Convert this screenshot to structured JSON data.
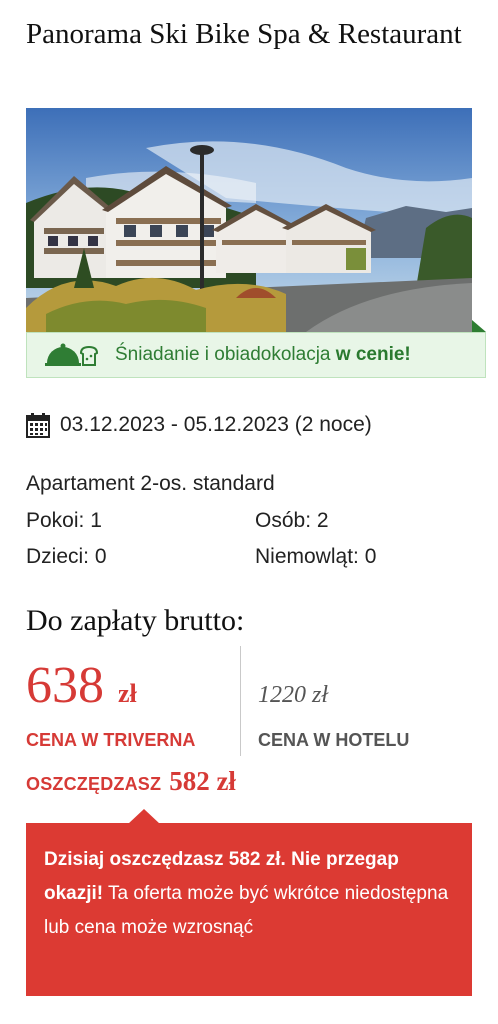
{
  "hotel": {
    "name": "Panorama Ski Bike Spa & Restaurant"
  },
  "badge": {
    "icon": "cloche-bread-icon",
    "text": "Śniadanie i obiadokolacja ",
    "emphasis": "w cenie!"
  },
  "stay": {
    "icon": "calendar-icon",
    "dates": "03.12.2023 - 05.12.2023 (2 noce)",
    "room_type": "Apartament 2-os. standard",
    "rooms_label": "Pokoi: 1",
    "persons_label": "Osób: 2",
    "children_label": "Dzieci: 0",
    "infants_label": "Niemowląt: 0"
  },
  "payment": {
    "title": "Do zapłaty brutto:",
    "triverna_price": "638",
    "currency": "zł",
    "triverna_label": "CENA W TRIVERNA",
    "hotel_price": "1220 zł",
    "hotel_label": "CENA W HOTELU",
    "savings_label": "OSZCZĘDZASZ",
    "savings_amount": "582 zł"
  },
  "alert": {
    "bold_text": "Dzisiaj oszczędzasz 582 zł. Nie przegap okazji!",
    "text": " Ta oferta może być wkrótce niedostępna lub cena może wzrosnąć"
  },
  "colors": {
    "accent_red": "#dc3a33",
    "badge_green": "#2f7d34",
    "badge_bg": "#e8f6e7"
  }
}
